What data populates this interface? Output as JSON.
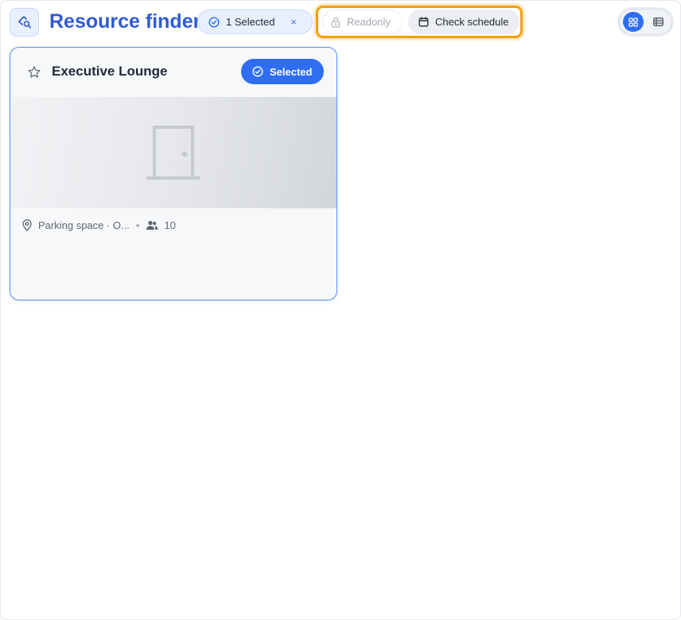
{
  "header": {
    "title": "Resource finder",
    "selection_chip": {
      "label": "1 Selected",
      "clear_glyph": "×"
    },
    "actions": {
      "readonly_label": "Readonly",
      "check_schedule_label": "Check schedule"
    },
    "view_toggle": {
      "active": "grid",
      "options": [
        "grid",
        "list"
      ]
    }
  },
  "cards": [
    {
      "title": "Executive Lounge",
      "favorite": false,
      "badge_label": "Selected",
      "image_icon": "door-icon",
      "location": "Parking space · O...",
      "capacity": "10"
    }
  ],
  "colors": {
    "accent": "#2f6ef3",
    "title": "#2f5bd1",
    "highlight_outline": "#f59e0b"
  },
  "icons": {
    "app": "search-map-icon",
    "chip": "check-circle-icon",
    "readonly": "lock-icon",
    "schedule": "calendar-icon",
    "grid_view": "grid-icon",
    "list_view": "list-icon",
    "favorite": "star-icon",
    "location": "map-pin-icon",
    "capacity": "users-icon"
  }
}
